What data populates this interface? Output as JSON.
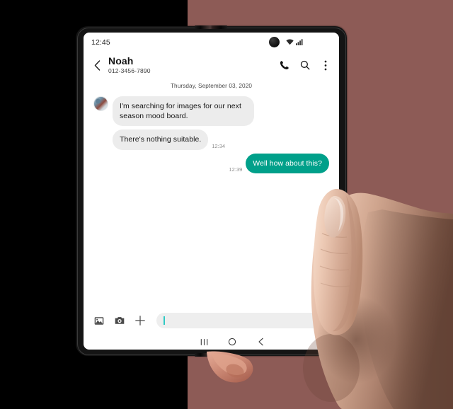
{
  "scene": {
    "background_left_color": "#000000",
    "background_right_color": "#8d5b56",
    "device_frame_color": "#141414"
  },
  "status_bar": {
    "time": "12:45",
    "wifi_icon": "wifi-icon",
    "signal_icon": "signal-bars-icon",
    "camera_punch_hole": "front-camera-icon"
  },
  "chat_header": {
    "back_icon": "chevron-left-icon",
    "contact_name": "Noah",
    "contact_number": "012-3456-7890",
    "actions": [
      {
        "name": "call-icon",
        "label": "Call"
      },
      {
        "name": "search-icon",
        "label": "Search"
      },
      {
        "name": "more-options-icon",
        "label": "More options"
      }
    ]
  },
  "conversation": {
    "date_divider": "Thursday, September 03, 2020",
    "messages": [
      {
        "direction": "in",
        "text": "I'm searching for images for our next season mood board.",
        "time": "",
        "avatar": "contact-avatar"
      },
      {
        "direction": "in",
        "text": "There's nothing suitable.",
        "time": "12:34",
        "avatar": ""
      },
      {
        "direction": "out",
        "text": "Well how about this?",
        "time": "12:39",
        "avatar": ""
      }
    ],
    "incoming_bubble_color": "#ececec",
    "outgoing_bubble_color": "#00a08a"
  },
  "composer": {
    "gallery_icon": "gallery-icon",
    "camera_icon": "camera-icon",
    "add_icon": "plus-icon",
    "input_value": "",
    "input_placeholder": "",
    "sticker_icon": "sticker-icon",
    "caret_color": "#2ec9c4"
  },
  "navigation_bar": {
    "recents_icon": "recents-icon",
    "home_icon": "home-icon",
    "back_icon": "back-icon"
  }
}
